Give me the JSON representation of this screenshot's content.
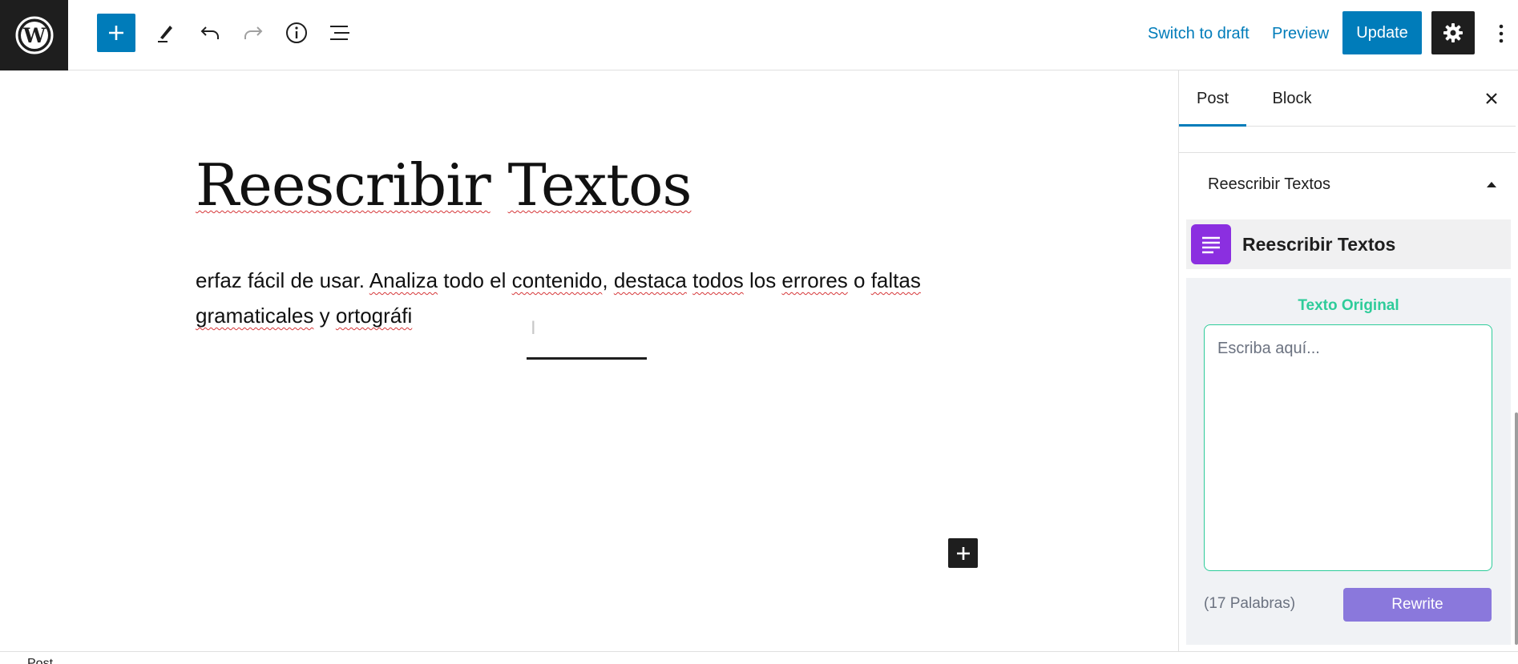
{
  "toolbar": {
    "switch_to_draft": "Switch to draft",
    "preview": "Preview",
    "update": "Update"
  },
  "icons": {
    "logo": "wordpress-logo",
    "add": "plus-icon",
    "tools": "pencil-icon",
    "undo": "undo-icon",
    "redo": "redo-icon",
    "details": "info-icon",
    "outline": "list-view-icon",
    "settings": "gear-icon",
    "options": "more-vertical-icon",
    "close": "close-icon",
    "toggle": "caret-up-icon",
    "plugin": "text-lines-icon",
    "inserter": "plus-icon"
  },
  "editor": {
    "title_words": [
      "Reescribir",
      "Textos"
    ],
    "paragraph": [
      {
        "t": "erfaz fácil de usar. ",
        "s": false
      },
      {
        "t": "Analiza",
        "s": true
      },
      {
        "t": " todo el ",
        "s": false
      },
      {
        "t": "contenido",
        "s": true
      },
      {
        "t": ", ",
        "s": false
      },
      {
        "t": "destaca",
        "s": true
      },
      {
        "t": " ",
        "s": false
      },
      {
        "t": "todos",
        "s": true
      },
      {
        "t": " los ",
        "s": false
      },
      {
        "t": "errores",
        "s": true
      },
      {
        "t": " o ",
        "s": false
      },
      {
        "t": "faltas",
        "s": true
      },
      {
        "t": " ",
        "s": false
      },
      {
        "t": "gramaticales",
        "s": true
      },
      {
        "t": " y ",
        "s": false
      },
      {
        "t": "ortográfi",
        "s": true
      }
    ]
  },
  "sidebar": {
    "tabs": [
      "Post",
      "Block"
    ],
    "panel_title": "Reescribir Textos",
    "plugin": {
      "title": "Reescribir Textos",
      "original_label": "Texto Original",
      "textarea_placeholder": "Escriba aquí...",
      "word_count": "(17 Palabras)",
      "rewrite_label": "Rewrite"
    }
  },
  "footer": {
    "breadcrumb": "Post"
  },
  "colors": {
    "accent": "#007cba",
    "dark": "#1e1e1e",
    "plugin_purple": "#8b2fe0",
    "teal": "#2ecc9a",
    "button_violet": "#8a78dc",
    "spell_error": "#d63638"
  }
}
